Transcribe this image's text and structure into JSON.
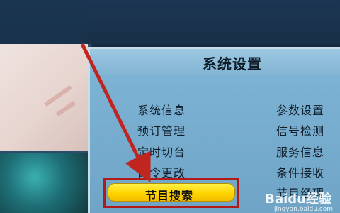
{
  "menu": {
    "title": "系统设置",
    "left_items": [
      "系统信息",
      "预订管理",
      "定时切台",
      "口令更改"
    ],
    "right_items": [
      "参数设置",
      "信号检测",
      "服务信息",
      "条件接收",
      "节目经理"
    ],
    "selected_item": "节目搜索"
  },
  "watermark": {
    "text": "Baidu经验",
    "url": "jingyan.baidu.com"
  },
  "colors": {
    "panel": "#7fb5d6",
    "highlight_box": "#b21a1a",
    "selected_fill": "#ffd400",
    "arrow": "#c0251f"
  }
}
